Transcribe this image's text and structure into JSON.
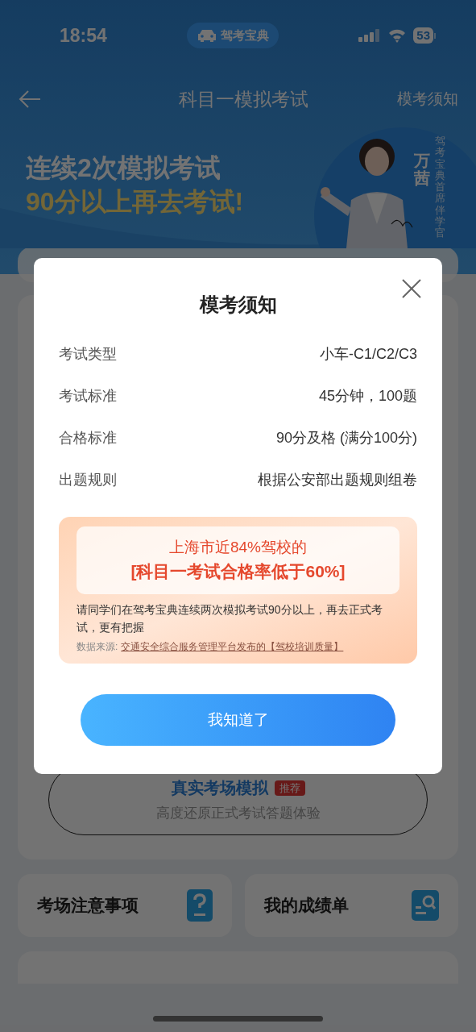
{
  "status_bar": {
    "time": "18:54",
    "app_pill": "驾考宝典",
    "battery": "53"
  },
  "nav": {
    "title": "科目一模拟考试",
    "right_link": "模考须知"
  },
  "banner": {
    "line1": "连续2次模拟考试",
    "line2": "90分以上再去考试!",
    "name": "万茜",
    "caption": "驾考宝典首席伴学官"
  },
  "exam_card": {
    "title": "真实考场模拟",
    "badge": "推荐",
    "subtitle": "高度还原正式考试答题体验"
  },
  "tiles": [
    {
      "label": "考场注意事项",
      "kind": "question"
    },
    {
      "label": "我的成绩单",
      "kind": "search"
    }
  ],
  "dialog": {
    "title": "模考须知",
    "rows": [
      {
        "label": "考试类型",
        "value": "小车-C1/C2/C3"
      },
      {
        "label": "考试标准",
        "value": "45分钟，100题"
      },
      {
        "label": "合格标准",
        "value": "90分及格 (满分100分)"
      },
      {
        "label": "出题规则",
        "value": "根据公安部出题规则组卷"
      }
    ],
    "notice": {
      "line1": "上海市近84%驾校的",
      "line2": "[科目一考试合格率低于60%]",
      "body": "请同学们在驾考宝典连续两次模拟考试90分以上，再去正式考试，更有把握",
      "source_label": "数据来源:",
      "source_link": "交通安全综合服务管理平台发布的【驾校培训质量】"
    },
    "button": "我知道了"
  }
}
